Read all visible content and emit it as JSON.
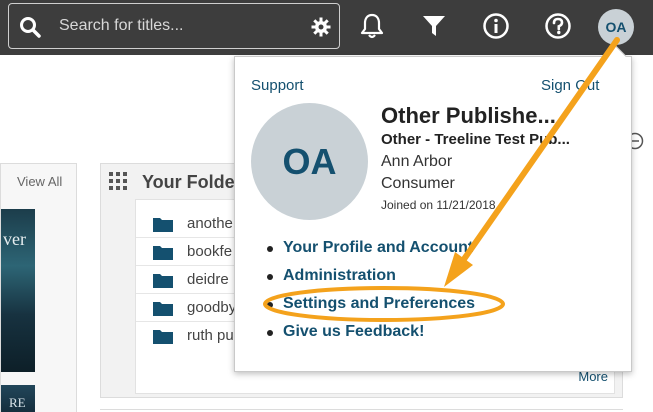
{
  "header": {
    "search_placeholder": "Search for titles...",
    "user_initials": "OA",
    "icons": [
      "search-icon",
      "gear-icon",
      "bell-icon",
      "filter-icon",
      "info-icon",
      "help-icon"
    ]
  },
  "background": {
    "left_panel_link": "View All",
    "cover_texts": [
      "ver",
      "RE"
    ],
    "folders_title": "Your Folde",
    "folders": [
      "anothe",
      "bookfe",
      "deidre",
      "goodby",
      "ruth pu"
    ],
    "more_link": "More"
  },
  "dropdown": {
    "support_link": "Support",
    "signout_link": "Sign Out",
    "avatar_initials": "OA",
    "profile": {
      "name": "Other Publishe...",
      "organization": "Other - Treeline Test Pub...",
      "city": "Ann Arbor",
      "type": "Consumer",
      "joined": "Joined on 11/21/2018"
    },
    "menu": [
      "Your Profile and Account",
      "Administration",
      "Settings and Preferences",
      "Give us Feedback!"
    ]
  },
  "colors": {
    "topbar": "#3d3d3d",
    "link": "#14506f",
    "annotation": "#f4a21c",
    "avatar_bg": "#c9d1d6"
  }
}
